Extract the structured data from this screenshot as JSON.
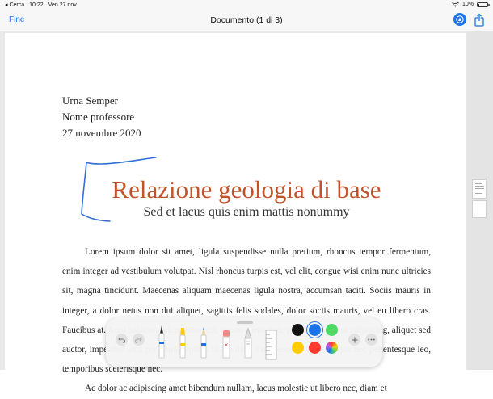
{
  "status_bar": {
    "back_app": "Cerca",
    "time": "10:22",
    "date": "Ven 27 nov",
    "battery_text": "10%",
    "battery_level": 0.1
  },
  "nav": {
    "done_label": "Fine",
    "title": "Documento (1 di 3)"
  },
  "document": {
    "author": "Urna Semper",
    "professor": "Nome professore",
    "date": "27 novembre 2020",
    "title": "Relazione geologia di base",
    "subtitle": "Sed et lacus quis enim mattis nonummy",
    "paragraph1": "Lorem ipsum dolor sit amet, ligula suspendisse nulla pretium, rhoncus tempor fermentum, enim integer ad vestibulum volutpat. Nisl rhoncus turpis est, vel elit, congue wisi enim nunc ultricies sit, magna tincidunt. Maecenas aliquam maecenas ligula nostra, accumsan taciti. Sociis mauris in integer, a dolor netus non dui aliquet, sagittis felis sodales, dolor sociis mauris, vel eu libero cras. Faucibus at. Arcu habitasse elementum est, ipsum purus pede porttitor class, ut adipiscing, aliquet sed auctor, imperdiet arcu per diam dapibus libero duis. Enim eros in vel, volutpat nec pellentesque leo, temporibus scelerisque nec.",
    "paragraph2": "Ac dolor ac adipiscing amet bibendum nullam, lacus molestie ut libero nec, diam et"
  },
  "palette": {
    "undo_icon": "undo-arrow-icon",
    "redo_icon": "redo-arrow-icon",
    "tools": [
      "pen",
      "highlighter",
      "pencil",
      "eraser",
      "lasso",
      "ruler"
    ],
    "colors": [
      "#111111",
      "#1a73e8",
      "#4cd964",
      "#ffcc00",
      "#ff3b30",
      "color-wheel"
    ],
    "selected_color": "#1a73e8",
    "add_icon": "plus-icon",
    "more_icon": "ellipsis-icon"
  },
  "colors": {
    "accent": "#1a73e8",
    "title": "#c0532a",
    "scribble": "#2f6fd6"
  }
}
